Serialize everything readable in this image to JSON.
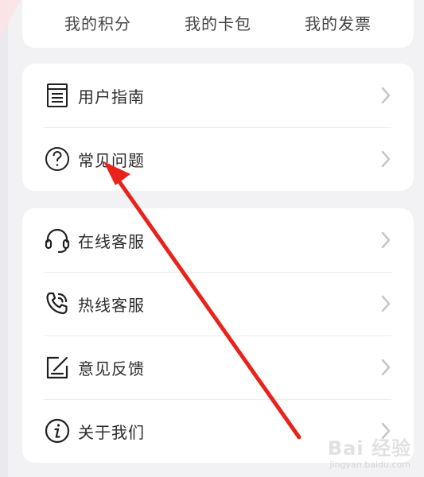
{
  "stats": [
    {
      "label": "我的积分",
      "icon": "points-icon"
    },
    {
      "label": "我的卡包",
      "icon": "card-wallet-icon"
    },
    {
      "label": "我的发票",
      "icon": "invoice-icon"
    }
  ],
  "guide_section": {
    "items": [
      {
        "label": "用户指南",
        "icon": "document-icon"
      },
      {
        "label": "常见问题",
        "icon": "question-icon"
      }
    ]
  },
  "service_section": {
    "items": [
      {
        "label": "在线客服",
        "icon": "headset-icon"
      },
      {
        "label": "热线客服",
        "icon": "phone-icon"
      },
      {
        "label": "意见反馈",
        "icon": "feedback-icon"
      },
      {
        "label": "关于我们",
        "icon": "info-icon"
      }
    ]
  },
  "colors": {
    "accent": "#e8231c",
    "text": "#2b2b2b",
    "icon": "#1f1f1f",
    "chevron": "#c6c6c6"
  },
  "watermark": {
    "text": "Bai 经验",
    "subtext": "jingyan.baidu.com"
  }
}
